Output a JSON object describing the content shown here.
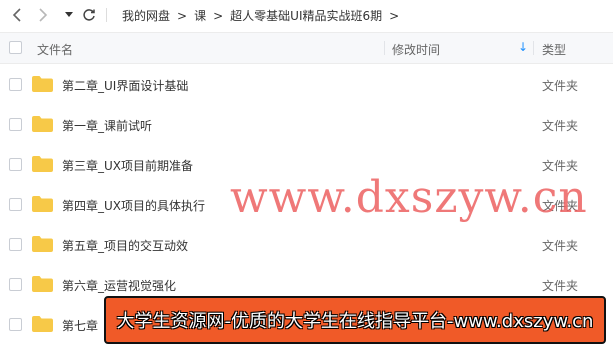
{
  "breadcrumb": [
    "我的网盘",
    "课",
    "超人零基础UI精品实战班6期"
  ],
  "breadcrumb_separator": ">",
  "columns": {
    "name": "文件名",
    "modified": "修改时间",
    "type": "类型",
    "sort_indicator": "↓"
  },
  "files": [
    {
      "name": "第二章_UI界面设计基础",
      "type": "文件夹"
    },
    {
      "name": "第一章_课前试听",
      "type": "文件夹"
    },
    {
      "name": "第三章_UX项目前期准备",
      "type": "文件夹"
    },
    {
      "name": "第四章_UX项目的具体执行",
      "type": "文件夹"
    },
    {
      "name": "第五章_项目的交互动效",
      "type": "文件夹"
    },
    {
      "name": "第六章_运营视觉强化",
      "type": "文件夹"
    },
    {
      "name": "第七章",
      "type": "文件夹"
    }
  ],
  "watermark": "www.dxszyw.cn",
  "banner": "大学生资源网-优质的大学生在线指导平台-www.dxszyw.cn",
  "colors": {
    "folder": "#f7c948",
    "banner_bg": "#f05a28",
    "watermark": "#ec5a5a",
    "sort_arrow": "#1e90ff"
  }
}
